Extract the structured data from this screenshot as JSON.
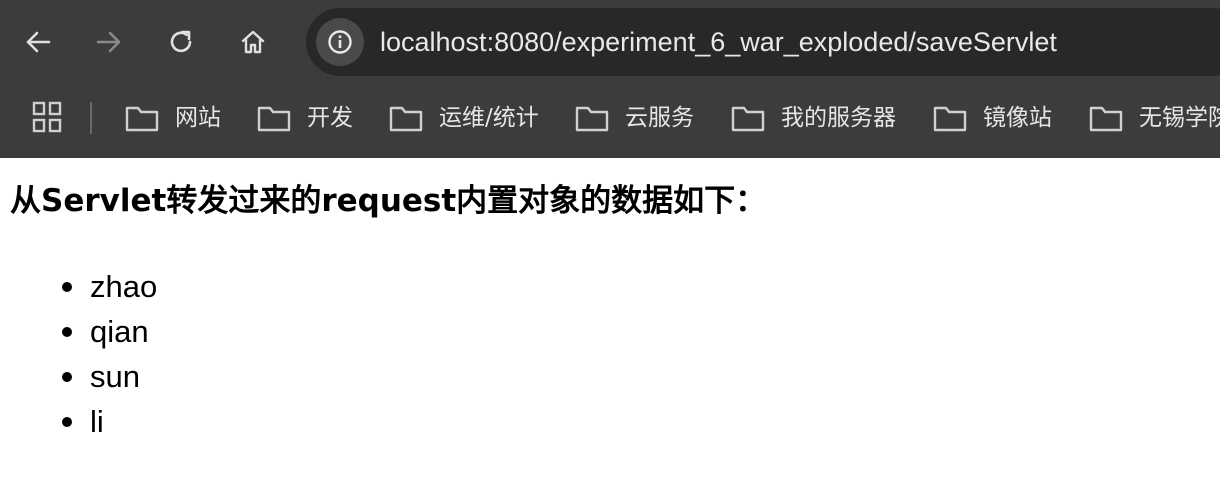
{
  "browser": {
    "url": "localhost:8080/experiment_6_war_exploded/saveServlet",
    "nav_icons": [
      "back-arrow-icon",
      "forward-arrow-icon",
      "reload-icon",
      "home-icon"
    ],
    "site_info_icon": "info-icon",
    "bookmarks": [
      {
        "label": "网站",
        "icon": "folder-icon"
      },
      {
        "label": "开发",
        "icon": "folder-icon"
      },
      {
        "label": "运维/统计",
        "icon": "folder-icon"
      },
      {
        "label": "云服务",
        "icon": "folder-icon"
      },
      {
        "label": "我的服务器",
        "icon": "folder-icon"
      },
      {
        "label": "镜像站",
        "icon": "folder-icon"
      },
      {
        "label": "无锡学院",
        "icon": "folder-icon"
      }
    ],
    "colors": {
      "toolbar_bg": "#3c3c3c",
      "omnibox_bg": "#282828",
      "text_light": "#e8e8e8"
    }
  },
  "page": {
    "heading": "从Servlet转发过来的request内置对象的数据如下：",
    "items": [
      "zhao",
      "qian",
      "sun",
      "li"
    ]
  }
}
